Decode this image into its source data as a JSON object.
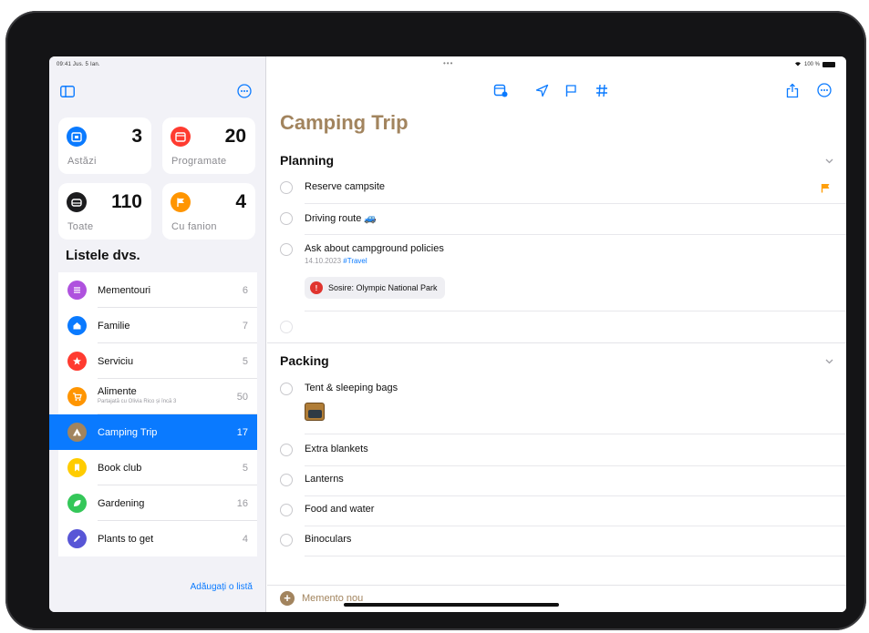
{
  "status": {
    "time_date": "09:41 Jus. 5 Ian.",
    "dots": "•••",
    "battery": "100 %"
  },
  "sidebar": {
    "tiles": [
      {
        "label": "Astăzi",
        "count": "3",
        "icon": "calendar-today-icon",
        "color": "#0a7aff"
      },
      {
        "label": "Programate",
        "count": "20",
        "icon": "calendar-icon",
        "color": "#ff3b30"
      },
      {
        "label": "Toate",
        "count": "110",
        "icon": "tray-icon",
        "color": "#1c1c1e"
      },
      {
        "label": "Cu fanion",
        "count": "4",
        "icon": "flag-icon",
        "color": "#ff9500"
      }
    ],
    "lists_header": "Listele dvs.",
    "lists": [
      {
        "label": "Mementouri",
        "count": "6",
        "icon": "list-icon",
        "color": "#af52de"
      },
      {
        "label": "Familie",
        "count": "7",
        "icon": "house-icon",
        "color": "#0a7aff"
      },
      {
        "label": "Serviciu",
        "count": "5",
        "icon": "star-icon",
        "color": "#ff3b30"
      },
      {
        "label": "Alimente",
        "sub": "Partajată cu Olivia Rico și încă 3",
        "count": "50",
        "icon": "cart-icon",
        "color": "#ff9500"
      },
      {
        "label": "Camping Trip",
        "count": "17",
        "icon": "tent-icon",
        "color": "#a2845e",
        "selected": true
      },
      {
        "label": "Book club",
        "count": "5",
        "icon": "bookmark-icon",
        "color": "#ffcc00"
      },
      {
        "label": "Gardening",
        "count": "16",
        "icon": "leaf-icon",
        "color": "#34c759"
      },
      {
        "label": "Plants to get",
        "count": "4",
        "icon": "pencil-icon",
        "color": "#5856d6"
      }
    ],
    "add_list": "Adăugați o listă"
  },
  "main": {
    "title": "Camping Trip",
    "title_color": "#a2845e",
    "sections": [
      {
        "title": "Planning",
        "tasks": [
          {
            "title": "Reserve campsite",
            "flagged": true
          },
          {
            "title": "Driving route 🚙"
          },
          {
            "title": "Ask about campground policies",
            "date": "14.10.2023",
            "tag": "#Travel",
            "chip": "Sosire: Olympic National Park"
          },
          {
            "title": ""
          }
        ]
      },
      {
        "title": "Packing",
        "tasks": [
          {
            "title": "Tent & sleeping bags",
            "has_image": true
          },
          {
            "title": "Extra blankets"
          },
          {
            "title": "Lanterns"
          },
          {
            "title": "Food and water"
          },
          {
            "title": "Binoculars"
          }
        ]
      }
    ],
    "new_reminder": "Memento nou"
  },
  "accent": "#0a7aff"
}
